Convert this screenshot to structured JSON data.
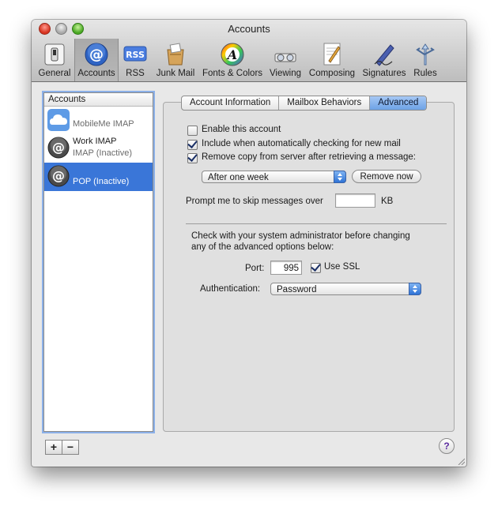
{
  "window": {
    "title": "Accounts"
  },
  "toolbar": {
    "items": [
      {
        "label": "General",
        "icon": "general-switch-icon"
      },
      {
        "label": "Accounts",
        "icon": "at-sign-icon",
        "selected": true
      },
      {
        "label": "RSS",
        "icon": "rss-icon"
      },
      {
        "label": "Junk Mail",
        "icon": "junk-mail-icon"
      },
      {
        "label": "Fonts & Colors",
        "icon": "fonts-colors-icon"
      },
      {
        "label": "Viewing",
        "icon": "viewing-glasses-icon"
      },
      {
        "label": "Composing",
        "icon": "composing-pencil-icon"
      },
      {
        "label": "Signatures",
        "icon": "signatures-pen-icon"
      },
      {
        "label": "Rules",
        "icon": "rules-icon"
      }
    ],
    "rss_badge": "RSS"
  },
  "sidebar": {
    "header": "Accounts",
    "accounts": [
      {
        "name": "MobileMe IMAP",
        "icon": "mobileme-cloud-icon"
      },
      {
        "name": "Work IMAP",
        "status": "IMAP (Inactive)",
        "icon": "at-sign-icon"
      },
      {
        "name": "POP (Inactive)",
        "icon": "at-sign-icon",
        "selected": true
      }
    ],
    "add_label": "+",
    "remove_label": "−"
  },
  "tabs": [
    {
      "label": "Account Information"
    },
    {
      "label": "Mailbox Behaviors"
    },
    {
      "label": "Advanced",
      "active": true
    }
  ],
  "advanced": {
    "enable_account": {
      "label": "Enable this account",
      "checked": false
    },
    "include_check": {
      "label": "Include when automatically checking for new mail",
      "checked": true
    },
    "remove_copy": {
      "label": "Remove copy from server after retrieving a message:",
      "checked": true
    },
    "remove_when": "After one week",
    "remove_now_label": "Remove now",
    "skip_prompt": "Prompt me to skip messages over",
    "skip_value": "",
    "skip_unit": "KB",
    "admin_note_line1": "Check with your system administrator before changing",
    "admin_note_line2": "any of the advanced options below:",
    "port_label": "Port:",
    "port_value": "995",
    "use_ssl": {
      "label": "Use SSL",
      "checked": true
    },
    "auth_label": "Authentication:",
    "auth_value": "Password"
  },
  "help_label": "?",
  "colors": {
    "selection": "#3a76d8",
    "tab_active": "#6da2e6"
  }
}
